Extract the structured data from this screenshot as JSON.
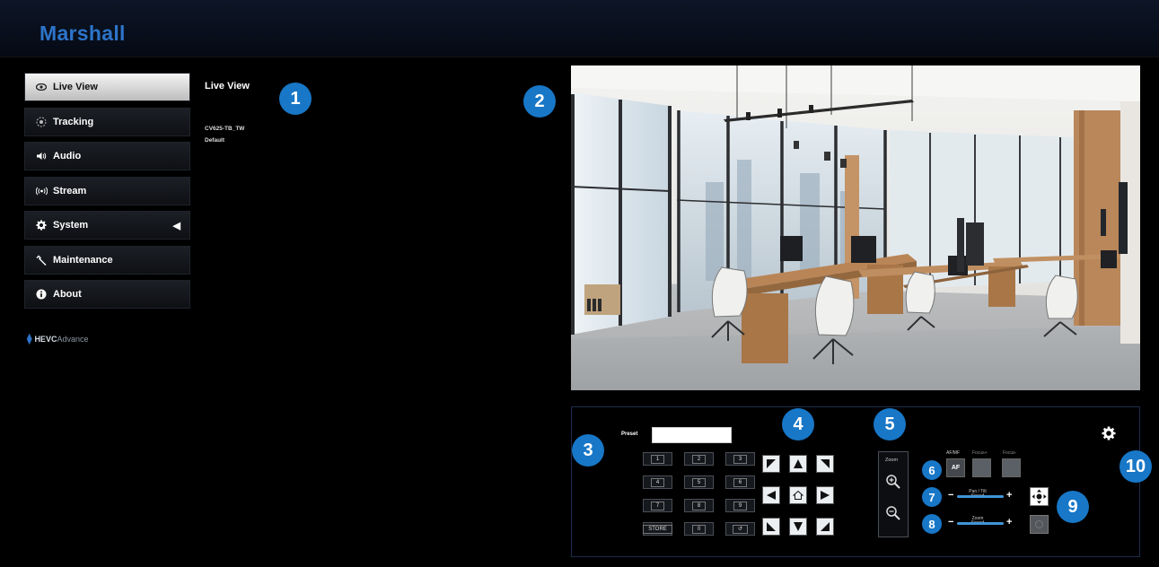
{
  "header": {
    "logo": "Marshall"
  },
  "sidebar": {
    "items": [
      {
        "label": "Live View",
        "icon": "eye-icon",
        "active": true
      },
      {
        "label": "Tracking",
        "icon": "tracking-icon"
      },
      {
        "label": "Audio",
        "icon": "speaker-icon"
      },
      {
        "label": "Stream",
        "icon": "stream-icon"
      },
      {
        "label": "System",
        "icon": "gear-icon"
      },
      {
        "label": "Maintenance",
        "icon": "wrench-icon"
      },
      {
        "label": "About",
        "icon": "info-icon"
      }
    ],
    "hevc": {
      "prefix": "HEVC",
      "suffix": "Advance"
    }
  },
  "main": {
    "title": "Live View",
    "device_name": "CV625-TB_TW",
    "profile": "Default"
  },
  "controls": {
    "preset": {
      "label": "Preset",
      "input_value": "",
      "buttons": [
        "1",
        "2",
        "3",
        "4",
        "5",
        "6",
        "7",
        "8",
        "9",
        "STORE",
        "0",
        "↺"
      ]
    },
    "zoom_label": "Zoom",
    "focus": {
      "label": "AF/MF",
      "label2": "Focus+",
      "label3": "Focus-",
      "af_button": "AF"
    },
    "pan_tilt_speed": {
      "label_line1": "Pan / Tilt",
      "label_line2": "Speed",
      "minus": "−",
      "plus": "+"
    },
    "zoom_speed": {
      "label_line1": "Zoom",
      "label_line2": "Speed",
      "minus": "−",
      "plus": "+"
    }
  },
  "callouts": [
    "1",
    "2",
    "3",
    "4",
    "5",
    "6",
    "7",
    "8",
    "9",
    "10"
  ],
  "colors": {
    "brand": "#2d74c9",
    "callout": "#1877c7",
    "panel_border": "#1e2c4d"
  }
}
